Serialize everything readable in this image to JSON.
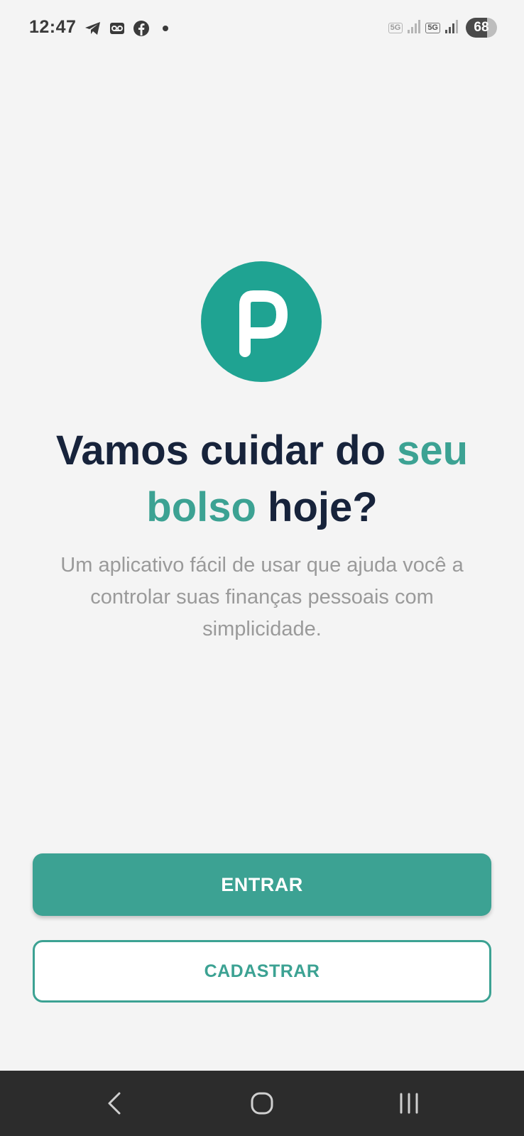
{
  "status_bar": {
    "time": "12:47",
    "left_icons": [
      "telegram-icon",
      "voicemail-icon",
      "facebook-icon",
      "notification-dot-icon"
    ],
    "network_1": "5G",
    "network_2": "5G",
    "battery": "68"
  },
  "logo": {
    "letter": "P",
    "color": "#1fa392"
  },
  "headline": {
    "part1": "Vamos cuidar do ",
    "accent": "seu bolso",
    "part2": " hoje?"
  },
  "subtitle": "Um aplicativo fácil de usar que ajuda você a controlar suas finanças pessoais com simplicidade.",
  "buttons": {
    "login": "ENTRAR",
    "register": "CADASTRAR"
  },
  "colors": {
    "accent": "#3ca293",
    "headline": "#17233b",
    "background": "#f4f4f4"
  },
  "nav_bar": {
    "items": [
      "back-icon",
      "home-icon",
      "recents-icon"
    ]
  }
}
